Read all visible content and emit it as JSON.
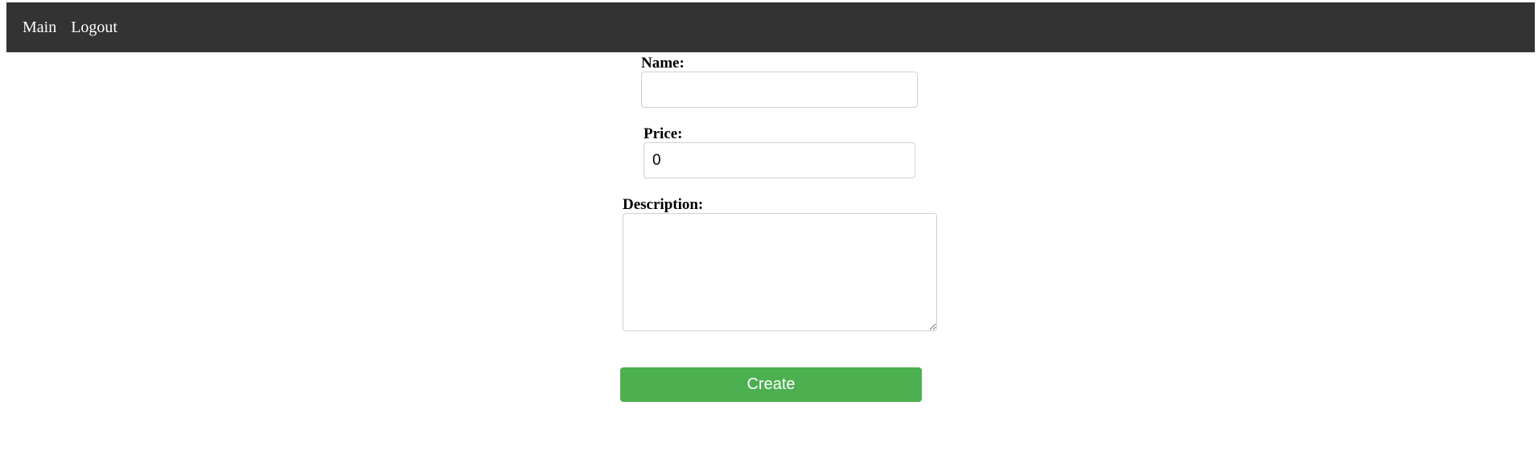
{
  "nav": {
    "items": [
      {
        "label": "Main"
      },
      {
        "label": "Logout"
      }
    ]
  },
  "form": {
    "name": {
      "label": "Name:",
      "value": ""
    },
    "price": {
      "label": "Price:",
      "value": "0"
    },
    "description": {
      "label": "Description:",
      "value": ""
    },
    "submit_label": "Create"
  },
  "colors": {
    "navbar_bg": "#333333",
    "button_bg": "#4caf50",
    "button_text": "#ffffff"
  }
}
